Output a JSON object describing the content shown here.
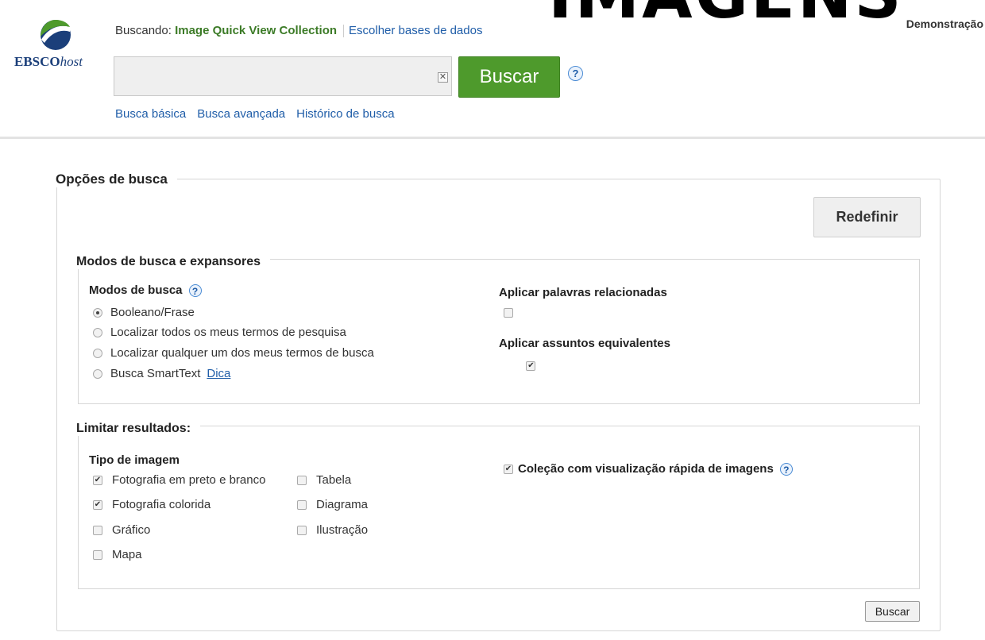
{
  "overlay_text": "IMAGENS",
  "logo": {
    "name": "EBSCO",
    "suffix": "host"
  },
  "header": {
    "searching_prefix": "Buscando:",
    "database": "Image Quick View Collection",
    "choose_db_link": "Escolher bases de dados",
    "demo_label": "Demonstração"
  },
  "search": {
    "value": "",
    "clear_glyph": "✕",
    "button_label": "Buscar",
    "help_glyph": "?"
  },
  "nav_links": [
    "Busca básica",
    "Busca avançada",
    "Histórico de busca"
  ],
  "options": {
    "title": "Opções de busca",
    "reset_label": "Redefinir",
    "modes_section": {
      "title": "Modos de busca e expansores",
      "modes_label": "Modos de busca",
      "modes": [
        {
          "label": "Booleano/Frase",
          "selected": true
        },
        {
          "label": "Localizar todos os meus termos de pesquisa",
          "selected": false
        },
        {
          "label": "Localizar qualquer um dos meus termos de busca",
          "selected": false
        },
        {
          "label": "Busca SmartText",
          "selected": false
        }
      ],
      "tip_link": "Dica",
      "related_words_label": "Aplicar palavras relacionadas",
      "related_words_checked": false,
      "equivalent_subjects_label": "Aplicar assuntos equivalentes",
      "equivalent_subjects_checked": true
    },
    "limit_section": {
      "title": "Limitar resultados:",
      "image_type_label": "Tipo de imagem",
      "image_types_col1": [
        {
          "label": "Fotografia em preto e branco",
          "checked": true
        },
        {
          "label": "Fotografia colorida",
          "checked": true
        },
        {
          "label": "Gráfico",
          "checked": false
        },
        {
          "label": "Mapa",
          "checked": false
        }
      ],
      "image_types_col2": [
        {
          "label": "Tabela",
          "checked": false
        },
        {
          "label": "Diagrama",
          "checked": false
        },
        {
          "label": "Ilustração",
          "checked": false
        }
      ],
      "quick_view_label": "Coleção com visualização rápida de imagens",
      "quick_view_checked": true
    },
    "search_button_label": "Buscar"
  },
  "colors": {
    "accent_green": "#4e9a2c",
    "link_blue": "#1f5da8",
    "db_green": "#3c7b27"
  }
}
